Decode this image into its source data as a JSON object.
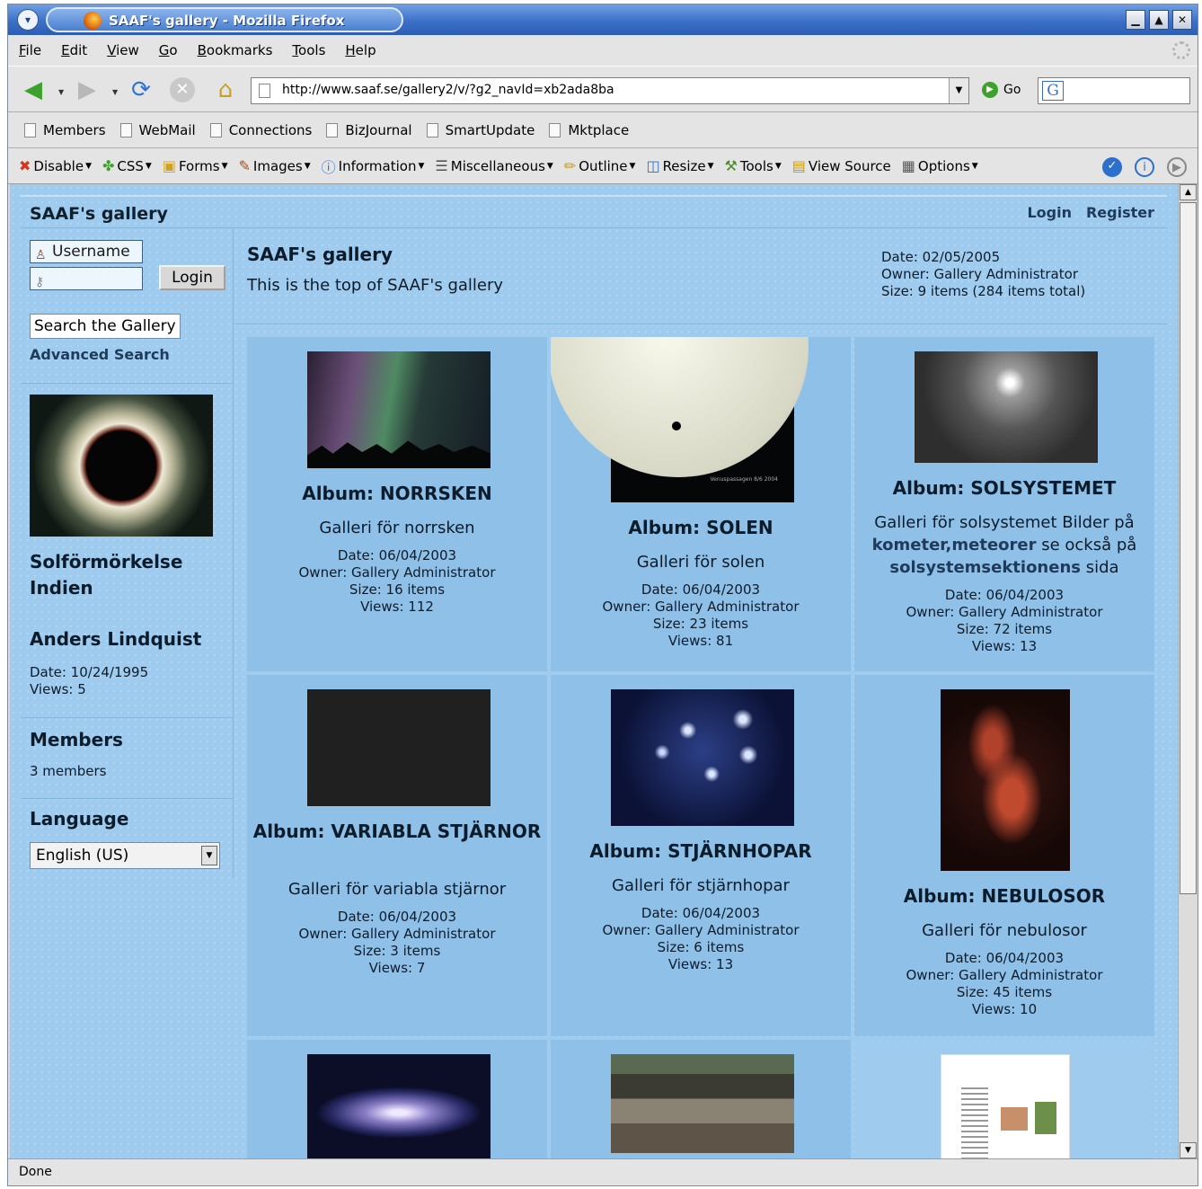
{
  "window": {
    "title": "SAAF's gallery - Mozilla Firefox",
    "menu_glyph": "▾",
    "controls": [
      "▁",
      "▲",
      "✕"
    ]
  },
  "menu": [
    "File",
    "Edit",
    "View",
    "Go",
    "Bookmarks",
    "Tools",
    "Help"
  ],
  "nav": {
    "url": "http://www.saaf.se/gallery2/v/?g2_navId=xb2ada8ba",
    "go_label": "Go",
    "search_icon_letter": "G"
  },
  "bookmarks": [
    "Members",
    "WebMail",
    "Connections",
    "BizJournal",
    "SmartUpdate",
    "Mktplace"
  ],
  "devtools": [
    "Disable",
    "CSS",
    "Forms",
    "Images",
    "Information",
    "Miscellaneous",
    "Outline",
    "Resize",
    "Tools",
    "View Source",
    "Options"
  ],
  "page": {
    "site_title": "SAAF's gallery",
    "login_link": "Login",
    "register_link": "Register"
  },
  "sidebar": {
    "username_placeholder": "Username",
    "login_button": "Login",
    "search_placeholder": "Search the Gallery",
    "advanced_search": "Advanced Search",
    "featured_title": "Solförmörkelse Indien",
    "featured_author": "Anders Lindquist",
    "featured_date": "Date: 10/24/1995",
    "featured_views": "Views: 5",
    "members_heading": "Members",
    "members_count": "3 members",
    "language_heading": "Language",
    "language_value": "English (US)"
  },
  "album": {
    "title": "SAAF's gallery",
    "description": "This is the top of SAAF's gallery",
    "date": "Date: 02/05/2005",
    "owner": "Owner: Gallery Administrator",
    "size": "Size: 9 items (284 items total)"
  },
  "albums": [
    {
      "title": "Album: NORRSKEN",
      "desc": "Galleri för norrsken",
      "date": "Date: 06/04/2003",
      "owner": "Owner: Gallery Administrator",
      "size": "Size: 16 items",
      "views": "Views: 112"
    },
    {
      "title": "Album: SOLEN",
      "desc": "Galleri för solen",
      "date": "Date: 06/04/2003",
      "owner": "Owner: Gallery Administrator",
      "size": "Size: 23 items",
      "views": "Views: 81",
      "thumb_caption": "Venuspassagen 8/6 2004"
    },
    {
      "title": "Album: SOLSYSTEMET",
      "desc_parts": [
        "Galleri för solsystemet Bilder på ",
        "kometer,meteorer",
        " se också på ",
        "solsystemsektionens",
        " sida"
      ],
      "date": "Date: 06/04/2003",
      "owner": "Owner: Gallery Administrator",
      "size": "Size: 72 items",
      "views": "Views: 13"
    },
    {
      "title": "Album: VARIABLA STJÄRNOR",
      "desc": "Galleri för variabla stjärnor",
      "date": "Date: 06/04/2003",
      "owner": "Owner: Gallery Administrator",
      "size": "Size: 3 items",
      "views": "Views: 7"
    },
    {
      "title": "Album: STJÄRNHOPAR",
      "desc": "Galleri för stjärnhopar",
      "date": "Date: 06/04/2003",
      "owner": "Owner: Gallery Administrator",
      "size": "Size: 6 items",
      "views": "Views: 13"
    },
    {
      "title": "Album: NEBULOSOR",
      "desc": "Galleri för nebulosor",
      "date": "Date: 06/04/2003",
      "owner": "Owner: Gallery Administrator",
      "size": "Size: 45 items",
      "views": "Views: 10"
    }
  ],
  "status": "Done"
}
